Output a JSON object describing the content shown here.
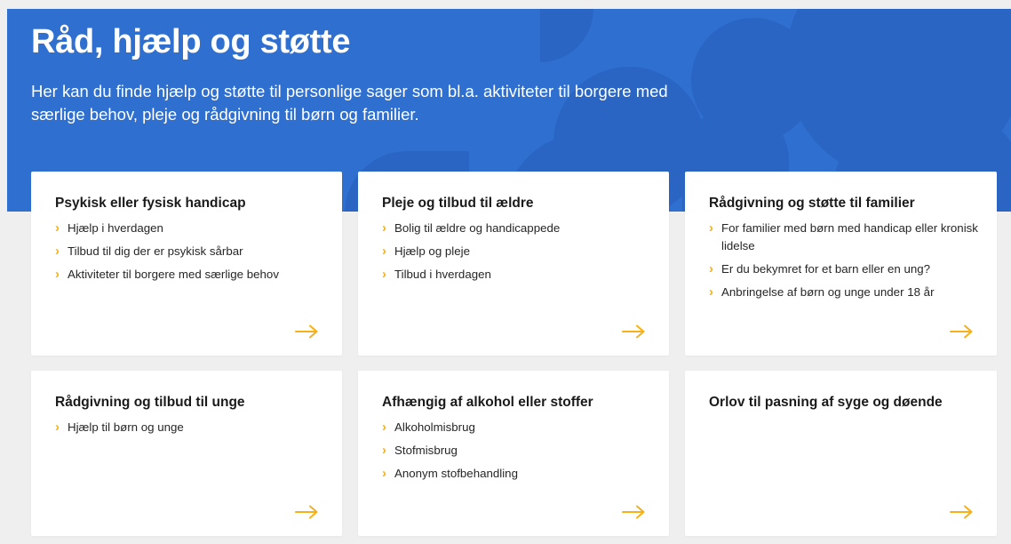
{
  "hero": {
    "title": "Råd, hjælp og støtte",
    "description": "Her kan du finde hjælp og støtte til personlige sager som bl.a. aktiviteter til borgere med særlige behov, pleje og rådgivning til børn og familier."
  },
  "colors": {
    "hero_bg": "#2f6fd0",
    "accent": "#f5b01a",
    "page_bg": "#efefef",
    "card_bg": "#ffffff"
  },
  "cards": [
    {
      "title": "Psykisk eller fysisk handicap",
      "items": [
        "Hjælp i hverdagen",
        "Tilbud til dig der er psykisk sårbar",
        "Aktiviteter til borgere med særlige behov"
      ],
      "arrow_icon": "arrow-right-icon"
    },
    {
      "title": "Pleje og tilbud til ældre",
      "items": [
        "Bolig til ældre og handicappede",
        "Hjælp og pleje",
        "Tilbud i hverdagen"
      ],
      "arrow_icon": "arrow-right-icon"
    },
    {
      "title": "Rådgivning og støtte til familier",
      "items": [
        "For familier med børn med handicap eller kronisk lidelse",
        "Er du bekymret for et barn eller en ung?",
        "Anbringelse af børn og unge under 18 år"
      ],
      "arrow_icon": "arrow-right-icon"
    },
    {
      "title": "Rådgivning og tilbud til unge",
      "items": [
        "Hjælp til børn og unge"
      ],
      "arrow_icon": "arrow-right-icon"
    },
    {
      "title": "Afhængig af alkohol eller stoffer",
      "items": [
        "Alkoholmisbrug",
        "Stofmisbrug",
        "Anonym stofbehandling"
      ],
      "arrow_icon": "arrow-right-icon"
    },
    {
      "title": "Orlov til pasning af syge og døende",
      "items": [],
      "arrow_icon": "arrow-right-icon"
    }
  ]
}
